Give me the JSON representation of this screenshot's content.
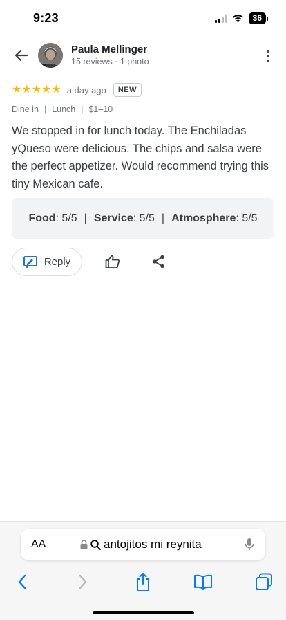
{
  "status_bar": {
    "time": "9:23",
    "battery": "36"
  },
  "header": {
    "reviewer_name": "Paula Mellinger",
    "reviewer_meta": "15 reviews · 1 photo"
  },
  "review": {
    "rating": 5,
    "stars": "★★★★★",
    "date": "a day ago",
    "badge": "NEW",
    "tags": [
      "Dine in",
      "Lunch",
      "$1–10"
    ],
    "text": "We stopped in for lunch today. The Enchiladas yQueso were delicious. The chips and salsa were the perfect appetizer. Would recommend trying this tiny Mexican cafe.",
    "sub_ratings": [
      {
        "label": "Food",
        "value": ": 5/5"
      },
      {
        "label": "Service",
        "value": ": 5/5"
      },
      {
        "label": "Atmosphere",
        "value": ": 5/5"
      }
    ]
  },
  "actions": {
    "reply_label": "Reply"
  },
  "browser": {
    "aa_label": "AA",
    "url": "antojitos mi reynita"
  },
  "colors": {
    "star": "#fbbc04",
    "accent": "#1a73e8",
    "safari_blue": "#007aff"
  },
  "icons": [
    "back-arrow-icon",
    "more-vert-icon",
    "reply-icon",
    "thumb-up-icon",
    "share-icon",
    "lock-icon",
    "search-icon",
    "mic-icon",
    "chevron-left-icon",
    "chevron-right-icon",
    "share-square-icon",
    "book-icon",
    "tabs-icon"
  ]
}
